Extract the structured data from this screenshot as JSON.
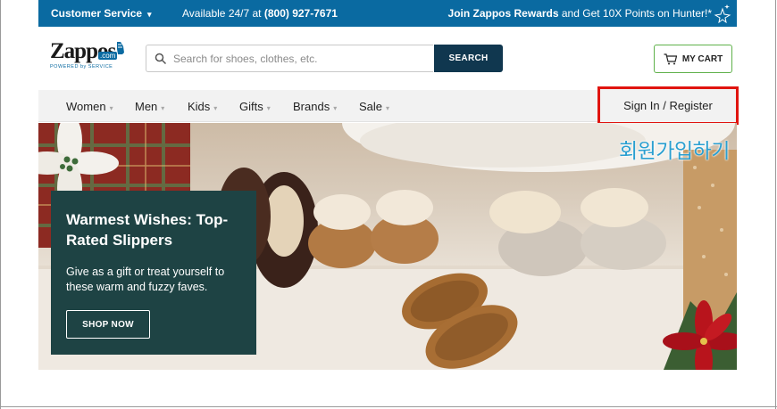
{
  "topbar": {
    "customer_service": "Customer Service",
    "availability_prefix": "Available 24/7 at ",
    "phone": "(800) 927-7671",
    "rewards_bold": "Join Zappos Rewards",
    "rewards_rest": " and Get 10X Points on Hunter!*"
  },
  "header": {
    "logo_text": "Zappos",
    "logo_com": ".com",
    "logo_tagline": "POWERED by SERVICE",
    "search_placeholder": "Search for shoes, clothes, etc.",
    "search_button": "SEARCH",
    "cart_label": "MY CART"
  },
  "nav": {
    "items": [
      {
        "label": "Women"
      },
      {
        "label": "Men"
      },
      {
        "label": "Kids"
      },
      {
        "label": "Gifts"
      },
      {
        "label": "Brands"
      },
      {
        "label": "Sale"
      }
    ],
    "sign_in": "Sign In / Register"
  },
  "annotation": {
    "text": "회원가입하기",
    "highlight_color": "#e0140f",
    "text_color": "#2a9fd0"
  },
  "hero": {
    "title": "Warmest Wishes: Top-Rated Slippers",
    "description": "Give as a gift or treat yourself to these warm and fuzzy faves.",
    "button": "SHOP NOW"
  },
  "colors": {
    "topbar": "#0a6aa1",
    "search_button": "#10374f",
    "cart_border": "#5fb14a",
    "hero_card": "#1e4344"
  }
}
